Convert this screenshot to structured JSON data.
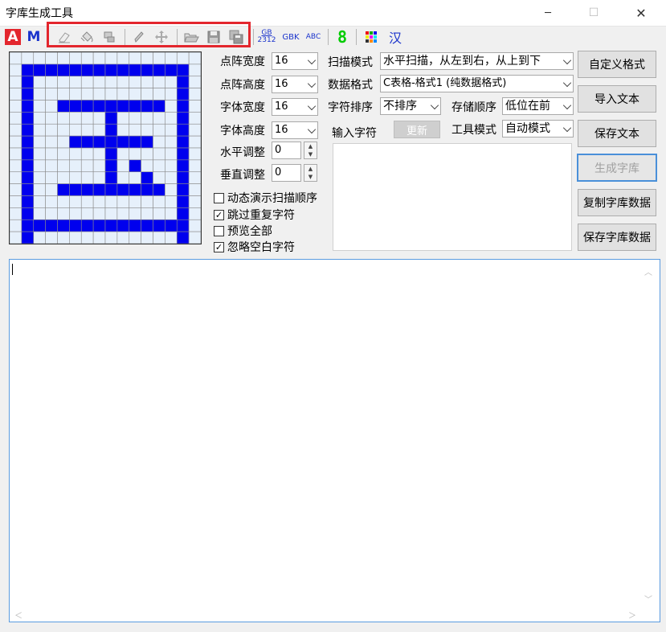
{
  "window": {
    "title": "字库生成工具",
    "min_label": "─",
    "max_label": "☐",
    "close_label": "✕"
  },
  "toolbar": {
    "a_label": "A",
    "m_label": "M",
    "gb2312_top": "GB",
    "gb2312_bottom": "2312",
    "gbk_label": "GBK",
    "abc_label": "ABC",
    "digit_label": "8",
    "han_label": "汉"
  },
  "grid": {
    "rows": 16,
    "cols": 16,
    "on_color": "#0000ee",
    "off_color": "#e6f0fb",
    "pattern": [
      "................",
      ".##############.",
      ".#............#.",
      ".#............#.",
      ".#..#########.#.",
      ".#......#.....#.",
      ".#......#.....#.",
      ".#...#######..#.",
      ".#......#.....#.",
      ".#......#.#...#.",
      ".#......#..#..#.",
      ".#..#########.#.",
      ".#............#.",
      ".#............#.",
      ".##############.",
      ".#............#."
    ]
  },
  "settings": {
    "matrix_width_label": "点阵宽度",
    "matrix_width_value": "16",
    "matrix_height_label": "点阵高度",
    "matrix_height_value": "16",
    "font_width_label": "字体宽度",
    "font_width_value": "16",
    "font_height_label": "字体高度",
    "font_height_value": "16",
    "h_adjust_label": "水平调整",
    "h_adjust_value": "0",
    "v_adjust_label": "垂直调整",
    "v_adjust_value": "0"
  },
  "options": {
    "animate_label": "动态演示扫描顺序",
    "animate_checked": false,
    "skip_dup_label": "跳过重复字符",
    "skip_dup_checked": true,
    "preview_all_label": "预览全部",
    "preview_all_checked": false,
    "ignore_blank_label": "忽略空白字符",
    "ignore_blank_checked": true,
    "check_mark": "✓"
  },
  "format": {
    "scan_mode_label": "扫描模式",
    "scan_mode_value": "水平扫描，从左到右，从上到下",
    "data_format_label": "数据格式",
    "data_format_value": "C表格-格式1 (纯数据格式)",
    "char_order_label": "字符排序",
    "char_order_value": "不排序",
    "store_order_label": "存储顺序",
    "store_order_value": "低位在前",
    "input_char_label": "输入字符",
    "update_label": "更新",
    "tool_mode_label": "工具模式",
    "tool_mode_value": "自动模式"
  },
  "buttons": {
    "custom_format": "自定义格式",
    "import_text": "导入文本",
    "save_text": "保存文本",
    "generate_font": "生成字库",
    "copy_font_data": "复制字库数据",
    "save_font_data": "保存字库数据"
  },
  "scroll": {
    "up": "︿",
    "down": "﹀",
    "left": "＜",
    "right": "＞"
  }
}
